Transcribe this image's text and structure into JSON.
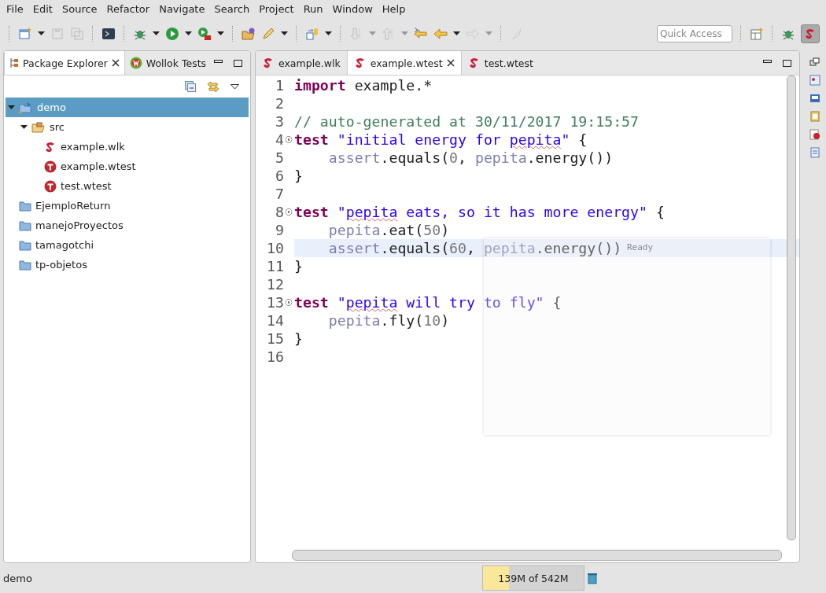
{
  "menu": [
    {
      "label": "File"
    },
    {
      "label": "Edit"
    },
    {
      "label": "Source"
    },
    {
      "label": "Refactor"
    },
    {
      "label": "Navigate"
    },
    {
      "label": "Search"
    },
    {
      "label": "Project"
    },
    {
      "label": "Run"
    },
    {
      "label": "Window"
    },
    {
      "label": "Help"
    }
  ],
  "quick_access": {
    "placeholder": "Quick Access"
  },
  "left_panel": {
    "tabs": [
      {
        "label": "Package Explorer",
        "kind": "explorer",
        "selected": true
      },
      {
        "label": "Wollok Tests",
        "kind": "tests",
        "selected": false
      }
    ],
    "tree": [
      {
        "label": "demo",
        "kind": "project",
        "selected": true,
        "expanded": true,
        "children": [
          {
            "label": "src",
            "kind": "source-folder",
            "selected": false,
            "expanded": true,
            "children": [
              {
                "label": "example.wlk",
                "kind": "wlk",
                "selected": false
              },
              {
                "label": "example.wtest",
                "kind": "wtest",
                "selected": false
              },
              {
                "label": "test.wtest",
                "kind": "wtest",
                "selected": false
              }
            ]
          }
        ]
      },
      {
        "label": "EjemploReturn",
        "kind": "folder",
        "selected": false
      },
      {
        "label": "manejoProyectos",
        "kind": "folder",
        "selected": false
      },
      {
        "label": "tamagotchi",
        "kind": "folder",
        "selected": false
      },
      {
        "label": "tp-objetos",
        "kind": "folder",
        "selected": false
      }
    ]
  },
  "editor": {
    "tabs": [
      {
        "label": "example.wlk",
        "selected": false
      },
      {
        "label": "example.wtest",
        "selected": true
      },
      {
        "label": "test.wtest",
        "selected": false
      }
    ],
    "lines": [
      {
        "number": "1",
        "fold": false,
        "current": false,
        "tokens": [
          {
            "kind": "keyword",
            "text": "import"
          },
          {
            "kind": "plain",
            "text": " example.*"
          }
        ]
      },
      {
        "number": "2",
        "fold": false,
        "current": false
      },
      {
        "number": "3",
        "fold": false,
        "current": false,
        "tokens": [
          {
            "kind": "comment",
            "text": "// auto-generated at 30/11/2017 19:15:57"
          }
        ]
      },
      {
        "number": "4",
        "fold": true,
        "current": false,
        "tokens": [
          {
            "kind": "keyword",
            "text": "test"
          },
          {
            "kind": "string",
            "text": " \"initial energy for "
          },
          {
            "kind": "misspelled",
            "text": "pepita"
          },
          {
            "kind": "string",
            "text": "\""
          },
          {
            "kind": "plain",
            "text": " {"
          }
        ]
      },
      {
        "number": "5",
        "fold": false,
        "current": false,
        "tokens": [
          {
            "kind": "ref",
            "text": "    assert"
          },
          {
            "kind": "plain",
            "text": ".equals("
          },
          {
            "kind": "number",
            "text": "0"
          },
          {
            "kind": "plain",
            "text": ", "
          },
          {
            "kind": "ref",
            "text": "pepita"
          },
          {
            "kind": "plain",
            "text": ".energy())"
          }
        ]
      },
      {
        "number": "6",
        "fold": false,
        "current": false,
        "tokens": [
          {
            "kind": "plain",
            "text": "}"
          }
        ]
      },
      {
        "number": "7",
        "fold": false,
        "current": false
      },
      {
        "number": "8",
        "fold": true,
        "current": false,
        "tokens": [
          {
            "kind": "keyword",
            "text": "test"
          },
          {
            "kind": "string",
            "text": " \""
          },
          {
            "kind": "misspelled",
            "text": "pepita"
          },
          {
            "kind": "string",
            "text": " eats, so it has more energy\""
          },
          {
            "kind": "plain",
            "text": " {"
          }
        ]
      },
      {
        "number": "9",
        "fold": false,
        "current": false,
        "tokens": [
          {
            "kind": "ref",
            "text": "    pepita"
          },
          {
            "kind": "plain",
            "text": ".eat("
          },
          {
            "kind": "number",
            "text": "50"
          },
          {
            "kind": "plain",
            "text": ")"
          }
        ]
      },
      {
        "number": "10",
        "fold": false,
        "current": true,
        "tokens": [
          {
            "kind": "ref",
            "text": "    assert"
          },
          {
            "kind": "plain",
            "text": ".equals("
          },
          {
            "kind": "number",
            "text": "60"
          },
          {
            "kind": "plain",
            "text": ", "
          },
          {
            "kind": "ref",
            "text": "pepita"
          },
          {
            "kind": "plain",
            "text": ".energy())"
          }
        ]
      },
      {
        "number": "11",
        "fold": false,
        "current": false,
        "tokens": [
          {
            "kind": "plain",
            "text": "}"
          }
        ]
      },
      {
        "number": "12",
        "fold": false,
        "current": false
      },
      {
        "number": "13",
        "fold": true,
        "current": false,
        "tokens": [
          {
            "kind": "keyword",
            "text": "test"
          },
          {
            "kind": "string",
            "text": " \""
          },
          {
            "kind": "misspelled",
            "text": "pepita"
          },
          {
            "kind": "string",
            "text": " will try to fly\""
          },
          {
            "kind": "plain",
            "text": " {"
          }
        ]
      },
      {
        "number": "14",
        "fold": false,
        "current": false,
        "tokens": [
          {
            "kind": "ref",
            "text": "    pepita"
          },
          {
            "kind": "plain",
            "text": ".fly("
          },
          {
            "kind": "number",
            "text": "10"
          },
          {
            "kind": "plain",
            "text": ")"
          }
        ]
      },
      {
        "number": "15",
        "fold": false,
        "current": false,
        "tokens": [
          {
            "kind": "plain",
            "text": "}"
          }
        ]
      },
      {
        "number": "16",
        "fold": false,
        "current": false
      }
    ],
    "popup": {
      "title": "Ready"
    }
  },
  "status_bar": {
    "text": "demo",
    "heap": {
      "reading": "139M of 542M",
      "level": 0.26
    }
  }
}
